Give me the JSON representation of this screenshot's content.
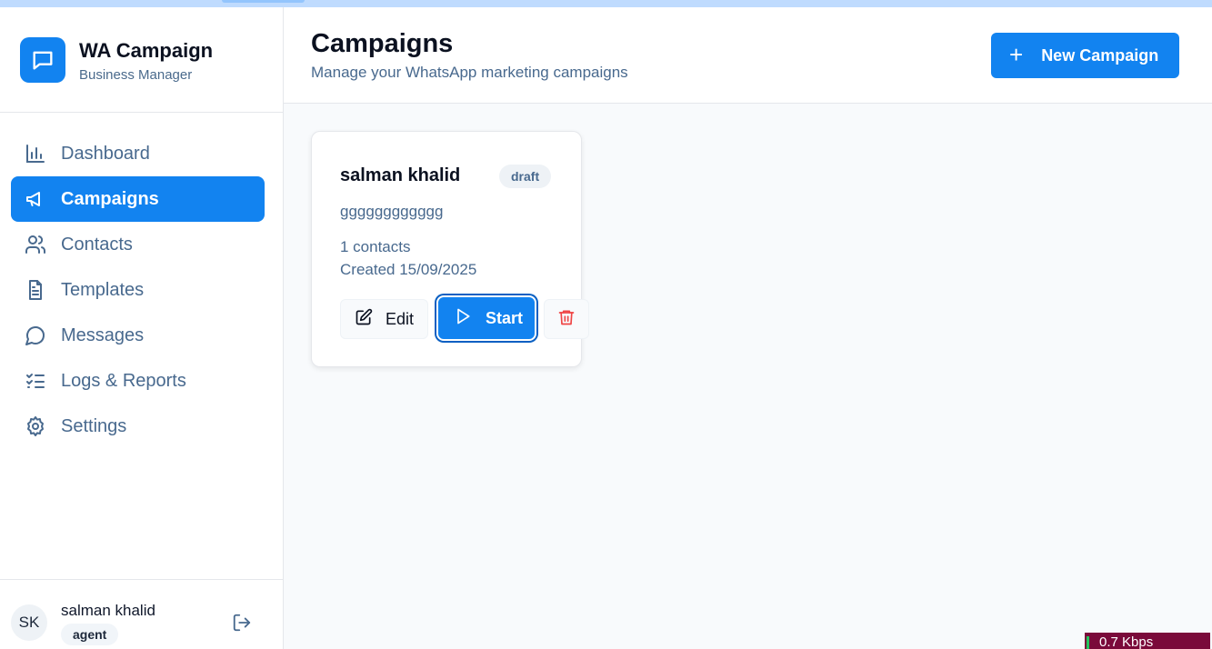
{
  "brand": {
    "title": "WA Campaign",
    "subtitle": "Business Manager"
  },
  "nav": {
    "items": [
      {
        "label": "Dashboard",
        "icon": "bar-chart-icon",
        "active": false
      },
      {
        "label": "Campaigns",
        "icon": "megaphone-icon",
        "active": true
      },
      {
        "label": "Contacts",
        "icon": "users-icon",
        "active": false
      },
      {
        "label": "Templates",
        "icon": "file-text-icon",
        "active": false
      },
      {
        "label": "Messages",
        "icon": "message-circle-icon",
        "active": false
      },
      {
        "label": "Logs & Reports",
        "icon": "list-checks-icon",
        "active": false
      },
      {
        "label": "Settings",
        "icon": "gear-icon",
        "active": false
      }
    ]
  },
  "user": {
    "initials": "SK",
    "name": "salman khalid",
    "role": "agent"
  },
  "header": {
    "title": "Campaigns",
    "subtitle": "Manage your WhatsApp marketing campaigns",
    "new_button": "New Campaign"
  },
  "campaigns": [
    {
      "name": "salman khalid",
      "status": "draft",
      "description": "gggggggggggg",
      "contacts": "1 contacts",
      "created": "Created 15/09/2025",
      "edit_label": "Edit",
      "start_label": "Start"
    }
  ],
  "network": {
    "speed": "0.7 Kbps"
  },
  "colors": {
    "accent": "#1283f0",
    "muted_text": "#48698e",
    "danger": "#ef4444"
  }
}
